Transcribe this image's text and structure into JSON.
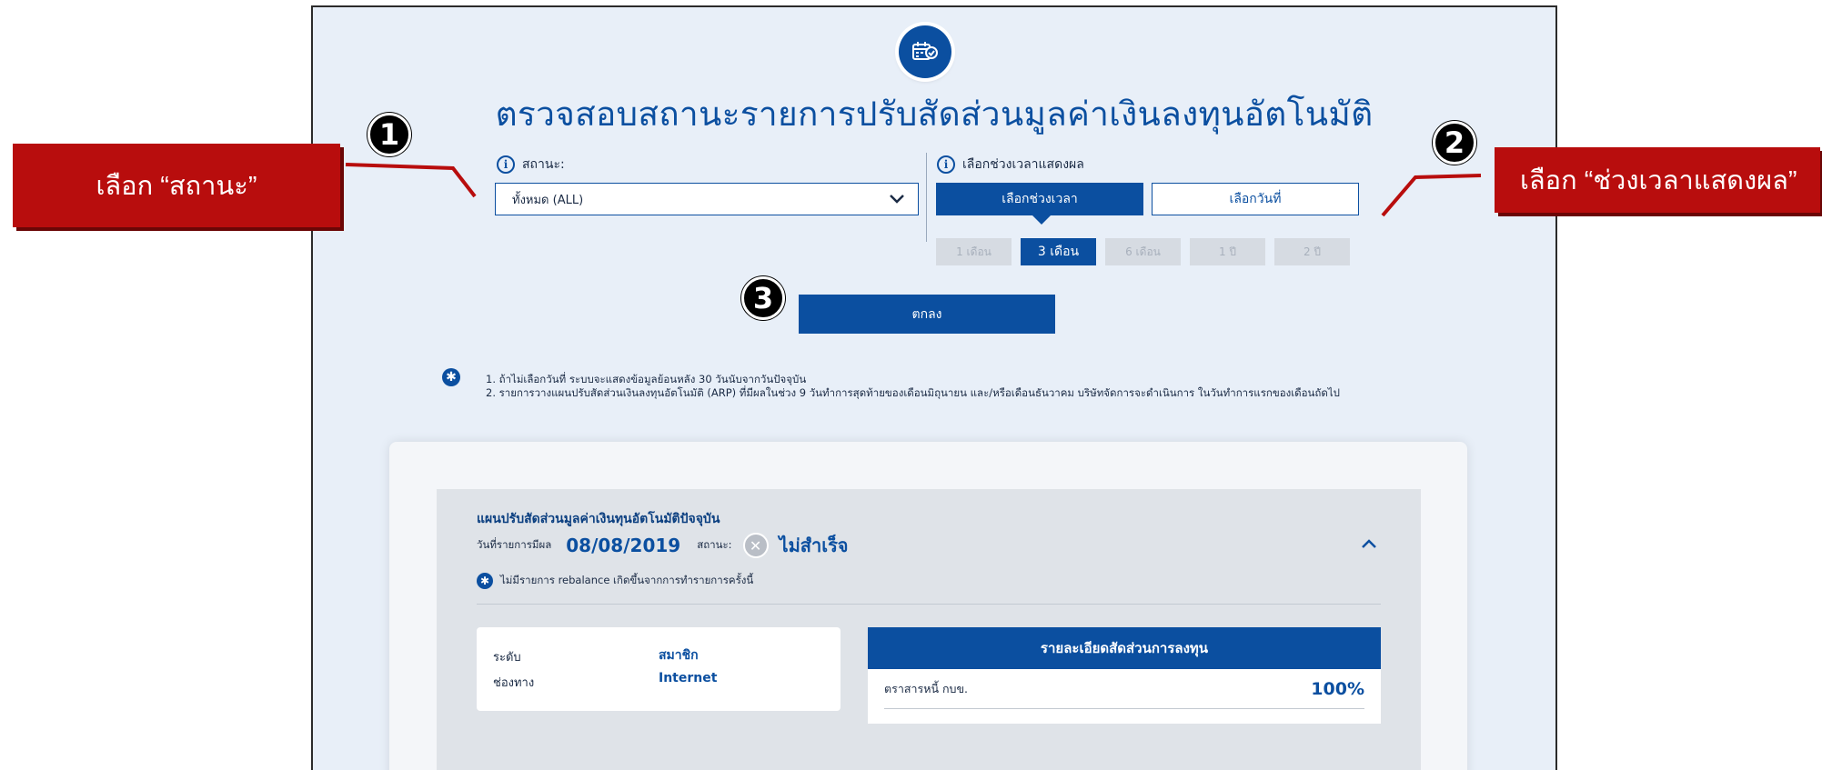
{
  "page": {
    "title": "ตรวจสอบสถานะรายการปรับสัดส่วนมูลค่าเงินลงทุนอัตโนมัติ",
    "status_label": "สถานะ:",
    "status_select_value": "ทั้งหมด (ALL)",
    "period_label": "เลือกช่วงเวลาแสดงผล",
    "select_period_tab": "เลือกช่วงเวลา",
    "select_date_tab": "เลือกวันที่",
    "periods": [
      "1 เดือน",
      "3 เดือน",
      "6 เดือน",
      "1 ปี",
      "2 ปี"
    ],
    "active_period_index": 1,
    "ok_button": "ตกลง",
    "notes": [
      "1. ถ้าไม่เลือกวันที่ ระบบจะแสดงข้อมูลย้อนหลัง 30 วันนับจากวันปัจจุบัน",
      "2. รายการวางแผนปรับสัดส่วนเงินลงทุนอัตโนมัติ (ARP) ที่มีผลในช่วง 9 วันทำการสุดท้ายของเดือนมิถุนายน และ/หรือเดือนธันวาคม บริษัทจัดการจะดำเนินการ ในวันทำการแรกของเดือนถัดไป"
    ]
  },
  "result": {
    "panel_title": "แผนปรับสัดส่วนมูลค่าเงินทุนอัตโนมัติปัจจุบัน",
    "effective_date_label": "วันที่รายการมีผล",
    "effective_date": "08/08/2019",
    "status_label": "สถานะ:",
    "status_text": "ไม่สำเร็จ",
    "note": "ไม่มีรายการ rebalance เกิดขึ้นจากการทำรายการครั้งนี้",
    "level_label": "ระดับ",
    "level_value": "สมาชิก",
    "channel_label": "ช่องทาง",
    "channel_value": "Internet",
    "detail_header": "รายละเอียดสัดส่วนการลงทุน",
    "detail_item_label": "ตราสารหนี้ กบข.",
    "detail_item_percent": "100%"
  },
  "callouts": {
    "left_text": "เลือก “สถานะ”",
    "right_text": "เลือก “ช่วงเวลาแสดงผล”",
    "badge_1": "1",
    "badge_2": "2",
    "badge_3": "3"
  },
  "colors": {
    "primary": "#0b4fa0",
    "callout_red": "#b80d0d",
    "page_bg": "#e8eff8",
    "disabled_period": "#d6dbe2"
  }
}
